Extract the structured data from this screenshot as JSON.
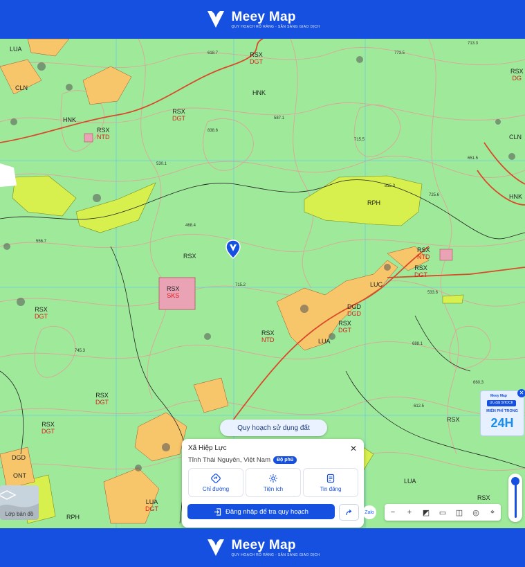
{
  "brand": {
    "name": "Meey Map",
    "tagline": "QUY HOẠCH RÕ RÀNG - SẴN SÀNG GIAO DỊCH"
  },
  "map": {
    "zone_labels": [
      {
        "top": "RSX",
        "bottom": "DGT"
      },
      {
        "top": "RSX",
        "bottom": "DGT"
      },
      {
        "top": "RSX",
        "bottom": "NTD"
      },
      {
        "top": "RPH",
        "bottom": ""
      },
      {
        "top": "RSX",
        "bottom": ""
      },
      {
        "top": "RSX",
        "bottom": "SKS"
      },
      {
        "top": "RSX",
        "bottom": "DGT"
      },
      {
        "top": "RSX",
        "bottom": "NTD"
      },
      {
        "top": "LUC",
        "bottom": ""
      },
      {
        "top": "DGD",
        "bottom": "DGD"
      },
      {
        "top": "LUA",
        "bottom": ""
      },
      {
        "top": "RSX",
        "bottom": "DGT"
      },
      {
        "top": "RSX",
        "bottom": "DGT"
      },
      {
        "top": "RSX",
        "bottom": "DGT"
      },
      {
        "top": "RSX",
        "bottom": "NTD"
      },
      {
        "top": "RSX",
        "bottom": "DGT"
      },
      {
        "top": "RSX",
        "bottom": "DG"
      },
      {
        "top": "CLN",
        "bottom": ""
      },
      {
        "top": "HNK",
        "bottom": ""
      },
      {
        "top": "RSX",
        "bottom": ""
      },
      {
        "top": "LUA",
        "bottom": ""
      },
      {
        "top": "RSX",
        "bottom": ""
      },
      {
        "top": "RPH",
        "bottom": ""
      },
      {
        "top": "LUA",
        "bottom": "DGT"
      },
      {
        "top": "DGD",
        "bottom": ""
      },
      {
        "top": "ONT",
        "bottom": ""
      },
      {
        "top": "HNK",
        "bottom": ""
      },
      {
        "top": "LUA",
        "bottom": ""
      },
      {
        "top": "CLN",
        "bottom": ""
      },
      {
        "top": "HNK",
        "bottom": ""
      }
    ],
    "elevations": [
      "713.3",
      "773.5",
      "838.6",
      "587.1",
      "715.5",
      "815.3",
      "725.6",
      "715.2",
      "688.1",
      "533.6",
      "468.4",
      "660.3",
      "556.7",
      "612.5",
      "745.3",
      "618.7",
      "651.5",
      "530.1"
    ]
  },
  "pin_icon": "location-pin-icon",
  "chip": {
    "label": "Quy hoạch sử dụng đất"
  },
  "card": {
    "title": "Xã Hiệp Lực",
    "subtitle": "Tỉnh Thái Nguyên, Việt Nam",
    "badge": "Độ phủ",
    "actions": [
      {
        "label": "Chỉ đường",
        "icon": "directions-icon"
      },
      {
        "label": "Tiện ích",
        "icon": "utilities-icon"
      },
      {
        "label": "Tin đăng",
        "icon": "listings-icon"
      }
    ],
    "login_label": "Đăng nhập để tra quy hoạch"
  },
  "layer_button": {
    "label": "Lớp bản đồ"
  },
  "zalo": {
    "label": "Zalo"
  },
  "ad": {
    "brand": "Meey Map",
    "promo": "Ưu đãi SHOCK",
    "free_text": "MIỄN PHÍ TRONG",
    "hours": "24H"
  },
  "colors": {
    "brand_blue": "#1550e0",
    "forest_green": "#9ee99a",
    "protection_yellow": "#d7f04e",
    "road_orange": "#f7c66a",
    "contour_pink": "#e99a9a",
    "mining_pink": "#e9a3b5"
  }
}
